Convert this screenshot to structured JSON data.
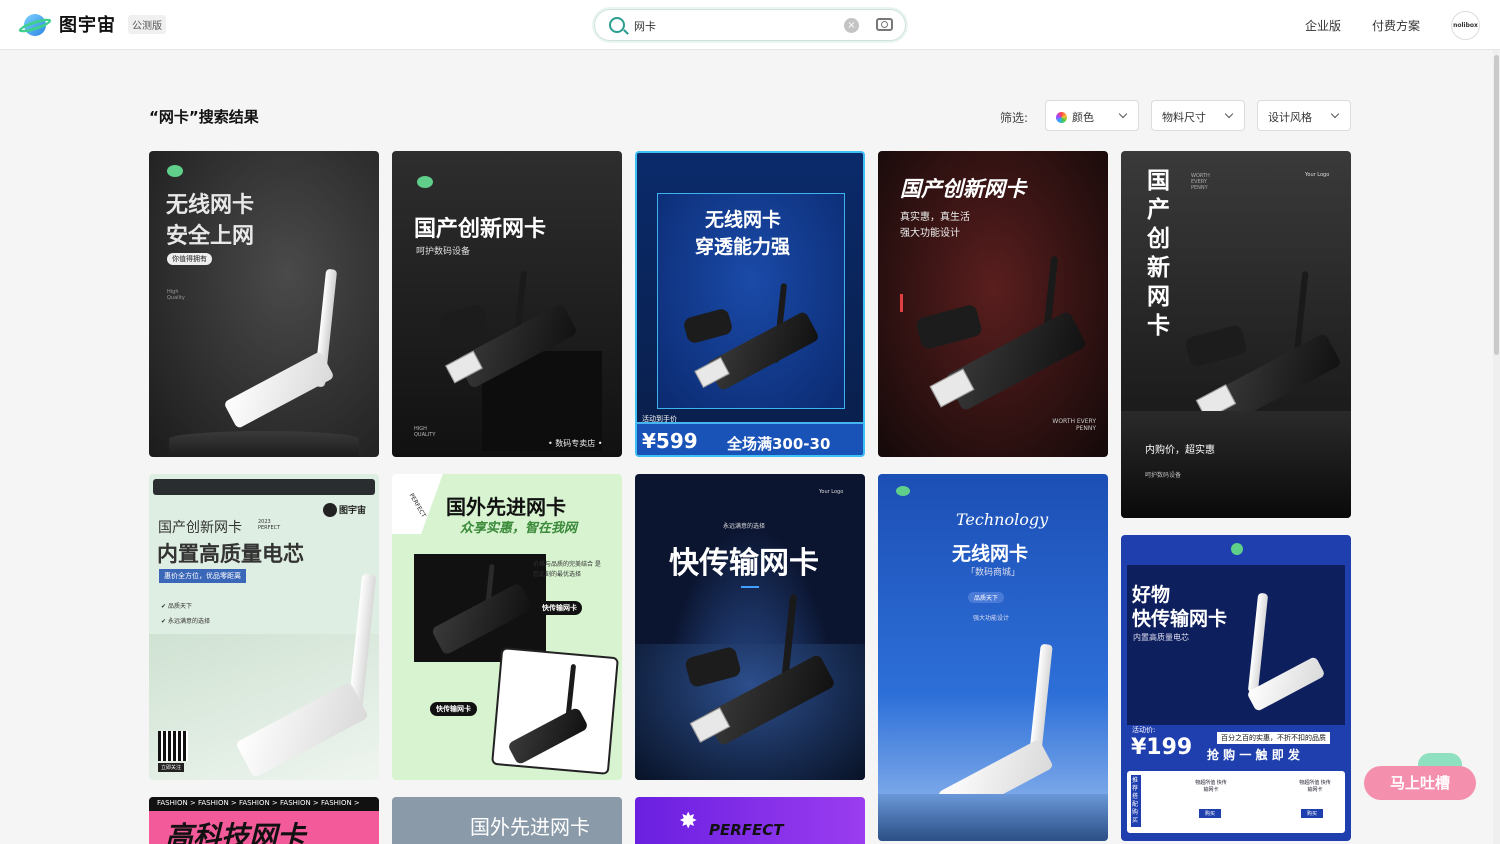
{
  "header": {
    "logo_text": "图宇宙",
    "beta_badge": "公测版",
    "search": {
      "value": "网卡"
    },
    "nav": [
      "企业版",
      "付费方案"
    ],
    "avatar_text": "nolibox"
  },
  "results": {
    "title": "“网卡”搜索结果",
    "filter_label": "筛选:",
    "filters": [
      "颜色",
      "物料尺寸",
      "设计风格"
    ]
  },
  "cards": [
    {
      "title_lines": [
        "无线网卡",
        "安全上网"
      ],
      "tag": "你值得拥有",
      "note": "High Quality"
    },
    {
      "title": "国产创新网卡",
      "subtitle": "呵护数码设备",
      "footer_left": "HIGH QUALITY",
      "footer_right": "• 数码专卖店 •"
    },
    {
      "title_lines": [
        "无线网卡",
        "穿透能力强"
      ],
      "price_label": "活动到手价",
      "price": "¥599",
      "promo": "全场满300-30"
    },
    {
      "title": "国产创新网卡",
      "lines": [
        "真实惠，真生活",
        "强大功能设计"
      ],
      "footer": "WORTH EVERY PENNY"
    },
    {
      "vertical_title": "国产创新网卡",
      "side_text": "WORTH EVERY PENNY",
      "logo": "Your Logo",
      "caption": "内购价，超实惠",
      "subcaption": "呵护数码设备"
    },
    {
      "brand": "图宇宙",
      "title_small": "国产创新网卡",
      "year": "2023 PERFECT",
      "title_big": "内置高质量电芯",
      "ribbon": "惠价全方位，优品零距离",
      "checks": [
        "品质天下",
        "永远满意的选择"
      ],
      "qr_label": "立即关注"
    },
    {
      "title": "国外先进网卡",
      "slogan": "众享实惠，智在我网",
      "blurb": "价格与品质的完美结合 是您此刻的最优选择",
      "tag": "快传输网卡",
      "stamp": "PERFECT"
    },
    {
      "logo": "Your Logo",
      "kicker": "永远满意的选择",
      "title": "快传输网卡"
    },
    {
      "script": "Technology",
      "title": "无线网卡",
      "subtitle": "「数码商城」",
      "tag": "品质天下",
      "note": "强大功能设计"
    },
    {
      "title_lines": [
        "好物",
        "快传输网卡"
      ],
      "subtitle": "内置高质量电芯",
      "price_label": "活动价:",
      "price": "¥199",
      "banner": "百分之百的实惠，不折不扣的品质",
      "cta": "抢 购 一 触 即 发",
      "side_vertical": "推荐搭配购买",
      "mini_text": "物超所值 快传输网卡",
      "mini_button": "购买"
    },
    {
      "ticker": "FASHION > FASHION > FASHION > FASHION > FASHION >",
      "title": "高科技网卡"
    },
    {
      "title": "国外先进网卡"
    },
    {
      "title": "PERFECT"
    }
  ],
  "feedback_button": "马上吐槽"
}
